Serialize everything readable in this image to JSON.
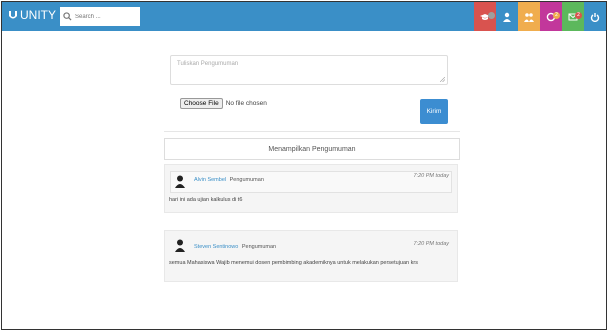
{
  "app": {
    "brand": "UNITY"
  },
  "search": {
    "placeholder": "Search ..."
  },
  "nav": {
    "icons": [
      {
        "name": "graduation-cap-icon",
        "color": "#d9534f",
        "badge": "",
        "badge_color": "#9e9e9e"
      },
      {
        "name": "user-icon",
        "color": "#3a8fc7",
        "badge": ""
      },
      {
        "name": "users-icon",
        "color": "#f0ad4e",
        "badge": ""
      },
      {
        "name": "notification-icon",
        "color": "#c2379b",
        "badge": "2",
        "badge_color": "#f0ad4e"
      },
      {
        "name": "envelope-icon",
        "color": "#5cb85c",
        "badge": "2",
        "badge_color": "#d9534f"
      },
      {
        "name": "power-icon",
        "color": "#3a8fc7",
        "badge": ""
      }
    ]
  },
  "composer": {
    "placeholder": "Tuliskan Pengumuman",
    "file_button": "Choose File",
    "file_status": "No file chosen",
    "submit_label": "Kirim"
  },
  "announcements": {
    "header": "Menampilkan Pengumuman",
    "items": [
      {
        "author": "Alvin Sembel",
        "action": "Pengumuman",
        "time": "7:20 PM today",
        "message": "hari ini ada ujian kalkulus di t6"
      },
      {
        "author": "Steven Sentinowo",
        "action": "Pengumuman",
        "time": "7:20 PM today",
        "message": "semua Mahasiswa Wajib menemui dosen pembimbing akademiknya untuk melakukan persetujuan krs"
      }
    ]
  },
  "colors": {
    "navbar": "#3a8fc7",
    "accent": "#3c8dd1"
  }
}
